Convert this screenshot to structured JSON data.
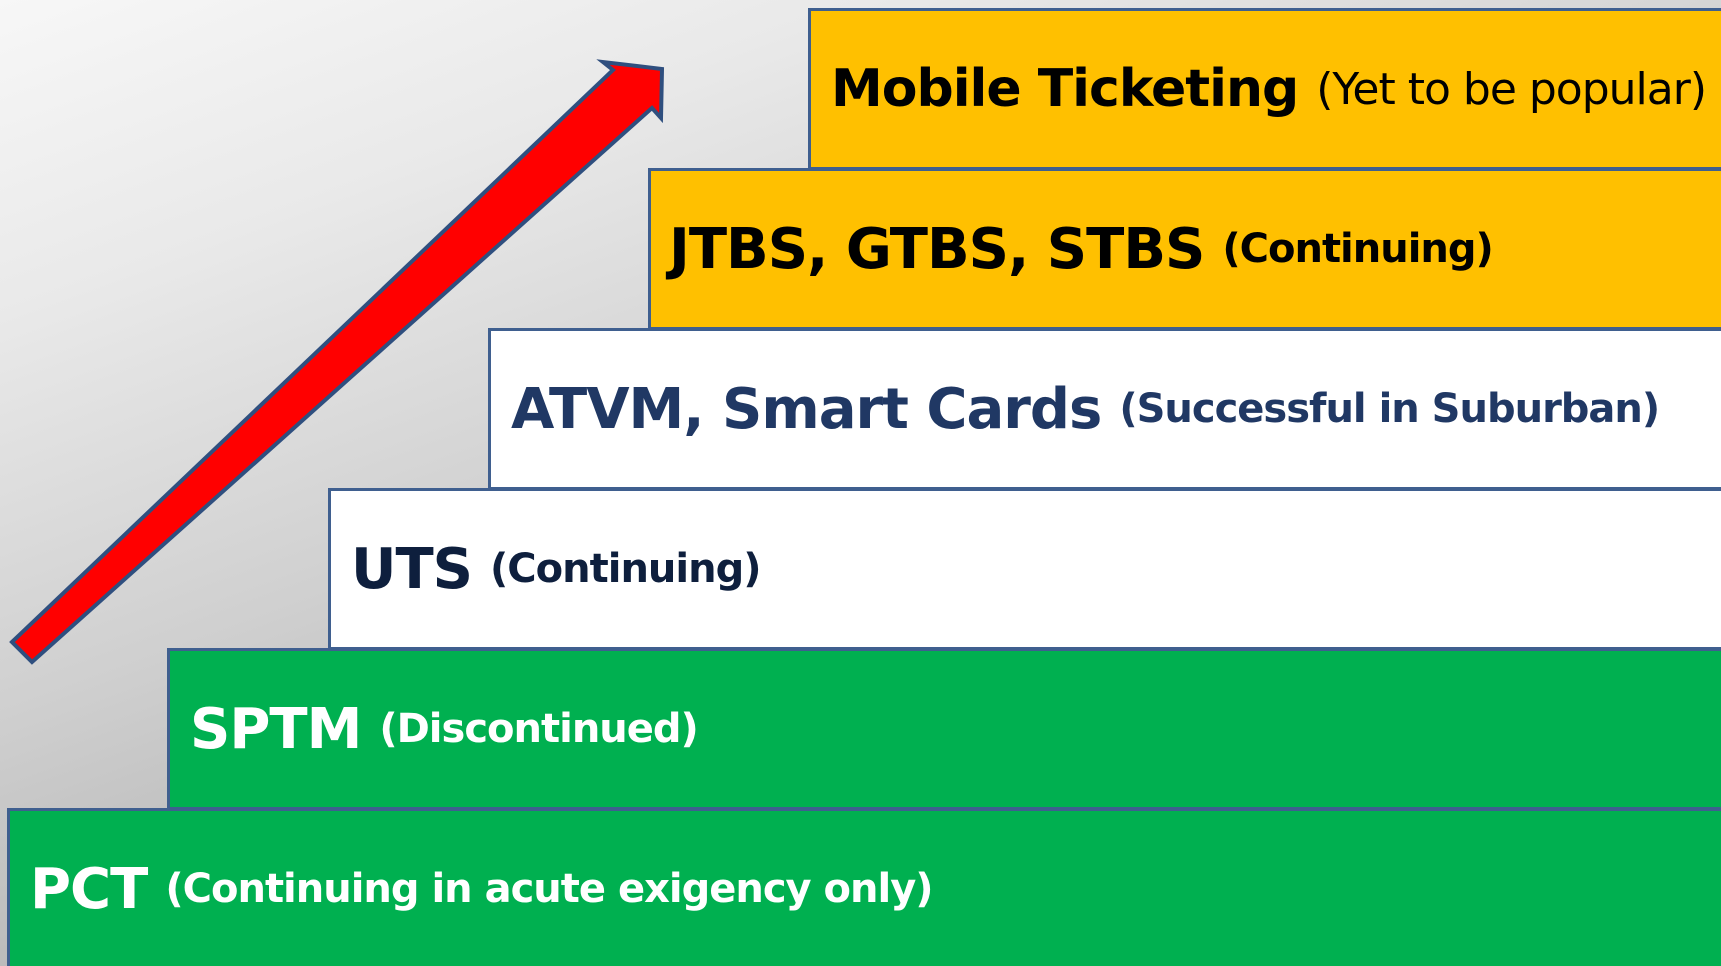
{
  "colors": {
    "gold": "#FFC000",
    "white": "#FFFFFF",
    "green": "#00B050",
    "border": "#3F5F8F",
    "dark_text": "#000000",
    "navy_text": "#1F3864",
    "white_text": "#FFFFFF",
    "arrow_fill": "#FF0000",
    "arrow_outline": "#2F4F7F"
  },
  "steps": [
    {
      "label": "Mobile Ticketing",
      "note": "(Yet to be popular)",
      "fill": "#FFC000",
      "text_color": "#000000"
    },
    {
      "label": "JTBS, GTBS, STBS",
      "note": "(Continuing)",
      "fill": "#FFC000",
      "text_color": "#000000"
    },
    {
      "label": "ATVM, Smart Cards",
      "note": "(Successful in Suburban)",
      "fill": "#FFFFFF",
      "text_color": "#203864"
    },
    {
      "label": "UTS",
      "note": "(Continuing)",
      "fill": "#FFFFFF",
      "text_color": "#0E1F3D"
    },
    {
      "label": "SPTM",
      "note": "(Discontinued)",
      "fill": "#00B050",
      "text_color": "#FFFFFF"
    },
    {
      "label": "PCT",
      "note": "(Continuing in acute exigency only)",
      "fill": "#00B050",
      "text_color": "#FFFFFF"
    }
  ],
  "arrow": {
    "icon": "up-right-arrow-icon"
  }
}
